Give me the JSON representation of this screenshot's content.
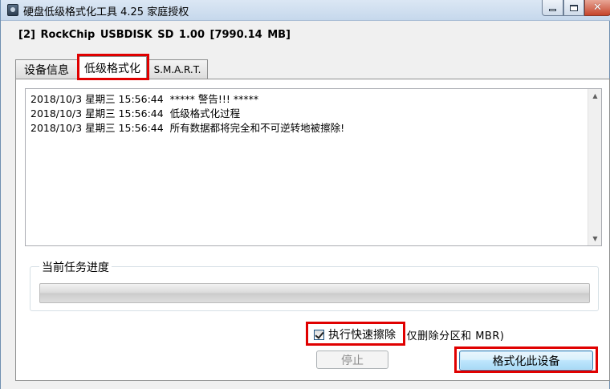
{
  "window": {
    "title": "硬盘低级格式化工具 4.25    家庭授权",
    "controls": {
      "minimize": "minimize-icon",
      "maximize": "maximize-icon",
      "close": "close-icon"
    }
  },
  "device": {
    "info": "[2]  RockChip USBDISK   SD   1.00   [7990.14 MB]"
  },
  "tabs": [
    {
      "label": "设备信息",
      "selected": false
    },
    {
      "label": "低级格式化",
      "selected": true
    },
    {
      "label": "S.M.A.R.T.",
      "selected": false
    }
  ],
  "log": {
    "lines": [
      "2018/10/3 星期三 15:56:44  ***** 警告!!! *****",
      "2018/10/3 星期三 15:56:44  低级格式化过程",
      "2018/10/3 星期三 15:56:44  所有数据都将完全和不可逆转地被擦除!"
    ]
  },
  "progress": {
    "title": "当前任务进度",
    "value": 0
  },
  "quick_erase": {
    "label": "执行快速擦除",
    "checked": true,
    "note": "(仅删除分区和 MBR)"
  },
  "buttons": {
    "stop": "停止",
    "format": "格式化此设备"
  },
  "colors": {
    "highlight": "#e00000",
    "titlebar": "#c6d8ec",
    "format_button": "#bee6fd"
  }
}
